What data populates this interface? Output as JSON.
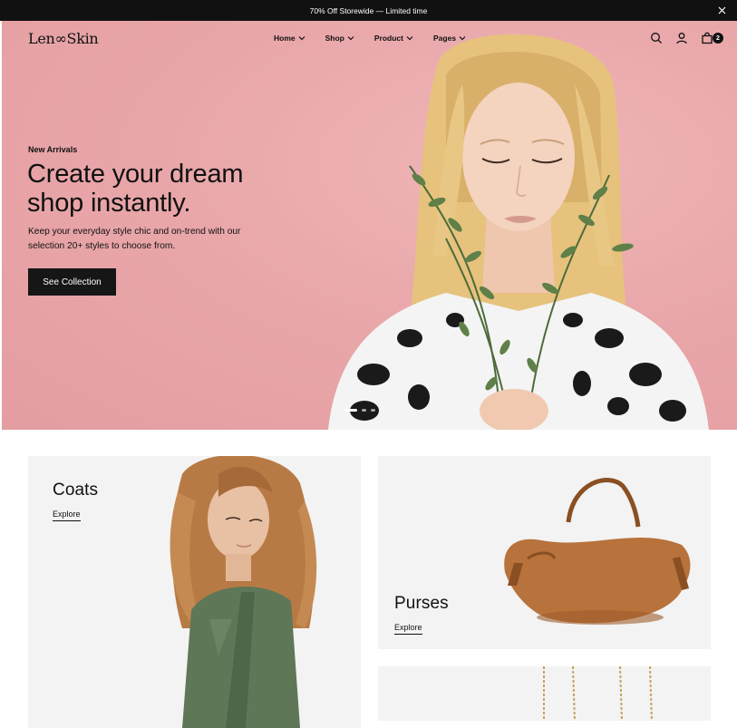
{
  "announcement": {
    "text": "70% Off Storewide — Limited time"
  },
  "brand": {
    "logo_text": "Len∞Skin"
  },
  "nav": {
    "items": [
      {
        "label": "Home"
      },
      {
        "label": "Shop"
      },
      {
        "label": "Product"
      },
      {
        "label": "Pages"
      }
    ],
    "cart_count": "2"
  },
  "hero": {
    "eyebrow": "New Arrivals",
    "headline_line1": "Create your dream",
    "headline_line2": "shop instantly.",
    "subcopy": "Keep your everyday style chic and on-trend with our selection 20+ styles to choose from.",
    "cta_label": "See Collection",
    "slides_total": 3,
    "active_slide": 1
  },
  "categories": [
    {
      "title": "Coats",
      "link": "Explore"
    },
    {
      "title": "Purses",
      "link": "Explore"
    }
  ],
  "colors": {
    "hero_bg": "#eaa9ad",
    "dark": "#111111",
    "card_bg": "#f3f3f3",
    "coat_green": "#5f7757",
    "bag_tan": "#b8723b"
  }
}
